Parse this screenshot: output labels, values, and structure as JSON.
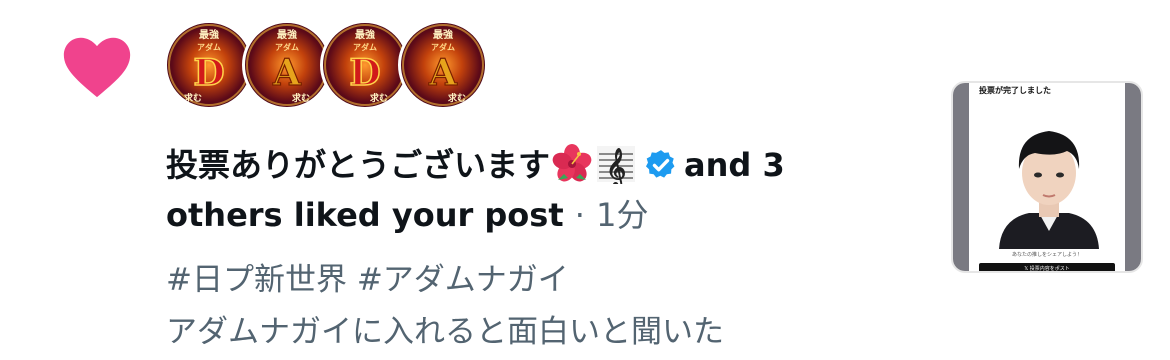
{
  "notification": {
    "type_icon": "heart-icon",
    "type_color": "#f0438d",
    "avatars": [
      {
        "letter": "D",
        "top_text": "最強",
        "mid_text": "アダム",
        "bottom_text": "求む"
      },
      {
        "letter": "A",
        "top_text": "最強",
        "mid_text": "アダム",
        "bottom_text": "求む"
      },
      {
        "letter": "D",
        "top_text": "最強",
        "mid_text": "アダム",
        "bottom_text": "求む"
      },
      {
        "letter": "A",
        "top_text": "最強",
        "mid_text": "アダム",
        "bottom_text": "求む"
      }
    ],
    "user_name": "投票ありがとうございます",
    "name_emojis": [
      "hibiscus-emoji",
      "treble-clef-emoji"
    ],
    "verified_icon": "verified-badge-icon",
    "verified_color": "#1d9bf0",
    "action_part1": "and 3",
    "action_part2": "others liked your post",
    "separator": "·",
    "time": "1分"
  },
  "post": {
    "line1": "#日プ新世界 #アダムナガイ",
    "line2": "アダムナガイに入れると面白いと聞いた"
  },
  "thumbnail": {
    "title": "投票が完了しました",
    "subtitle": "あなたの推しをシェアしよう！",
    "button_label": "𝕏  投票内容をポスト"
  },
  "colors": {
    "text_primary": "#0f1419",
    "text_secondary": "#536471"
  }
}
